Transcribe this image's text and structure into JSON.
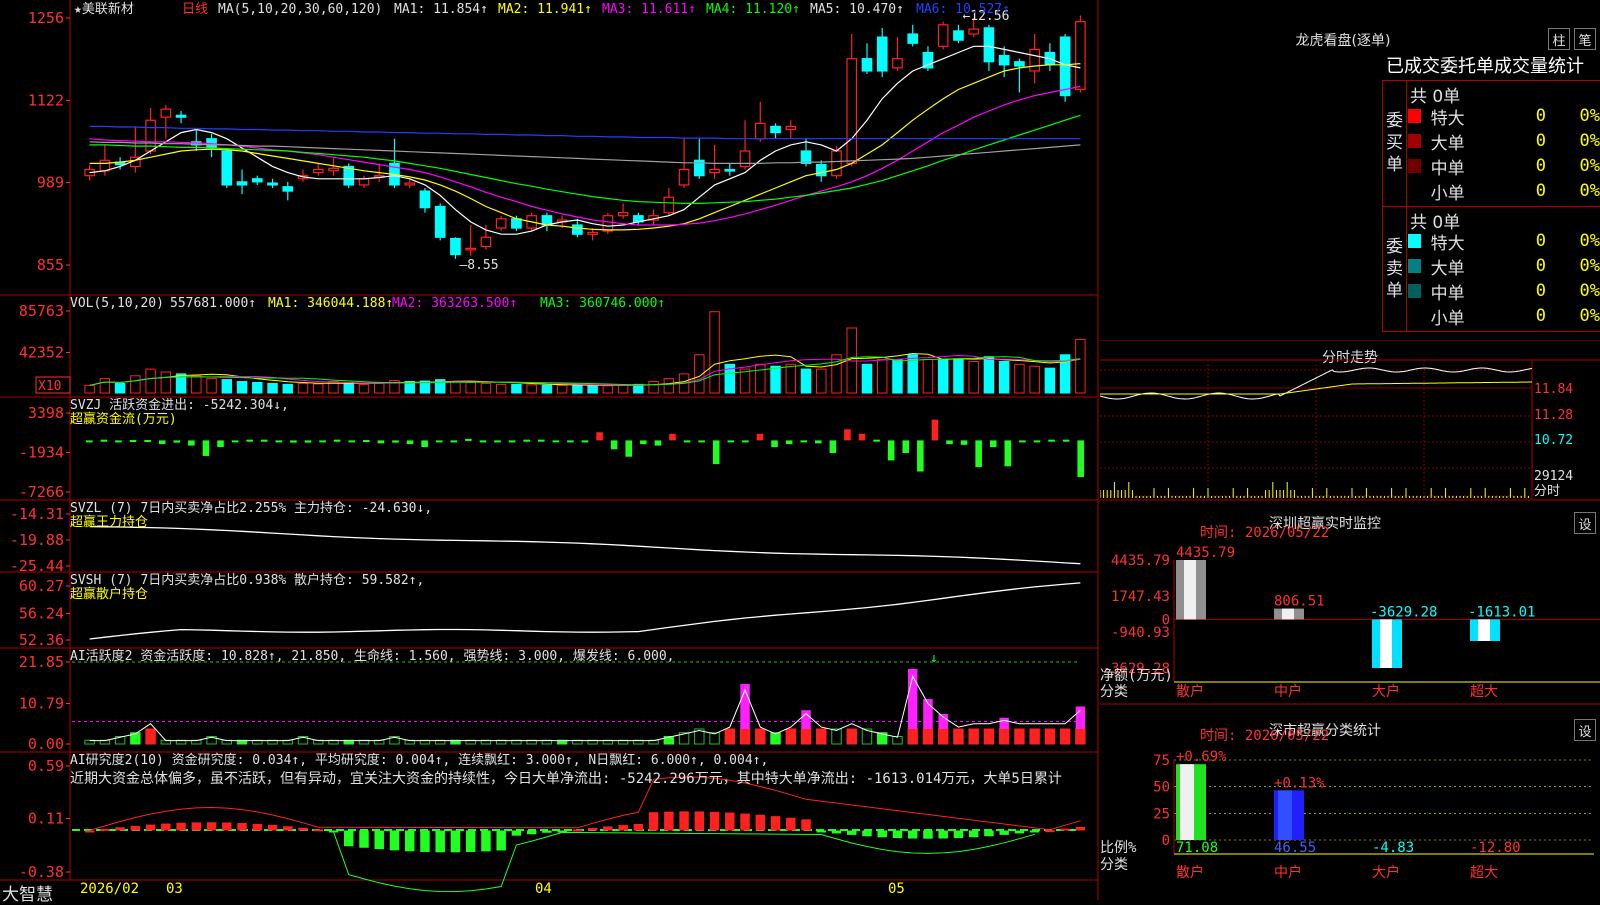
{
  "stock": {
    "name": "★美联新材",
    "period": "日线",
    "ma_params": "MA(5,10,20,30,60,120)",
    "ma1": "MA1: 11.854↑",
    "ma2": "MA2: 11.941↑",
    "ma3": "MA3: 11.611↑",
    "ma4": "MA4: 11.120↑",
    "ma5": "MA5: 10.470↑",
    "ma6": "MA6: 10.527↑",
    "high_mark": "12.56",
    "low_mark": "8.55",
    "y_ticks": [
      "1256",
      "1122",
      "989",
      "855"
    ]
  },
  "colors": {
    "up": "#ff2020",
    "down": "#00ffff",
    "ma1": "#ffffff",
    "ma2": "#ffff00",
    "ma3": "#ff00ff",
    "ma4": "#00ff00",
    "ma5": "#a0a0a0",
    "ma6": "#2040ff",
    "grid": "#b00000",
    "axis_text": "#ff3030"
  },
  "chart_data": [
    {
      "type": "candlestick",
      "title": "美联新材 日线",
      "ylim": [
        855,
        1256
      ],
      "candles": [
        {
          "o": 1000,
          "c": 1010,
          "h": 1018,
          "l": 992
        },
        {
          "o": 1008,
          "c": 1025,
          "h": 1050,
          "l": 1000
        },
        {
          "o": 1022,
          "c": 1018,
          "h": 1030,
          "l": 1010
        },
        {
          "o": 1015,
          "c": 1030,
          "h": 1080,
          "l": 1005
        },
        {
          "o": 1040,
          "c": 1090,
          "h": 1110,
          "l": 1035
        },
        {
          "o": 1095,
          "c": 1108,
          "h": 1115,
          "l": 1060
        },
        {
          "o": 1098,
          "c": 1095,
          "h": 1105,
          "l": 1085
        },
        {
          "o": 1055,
          "c": 1050,
          "h": 1075,
          "l": 1040
        },
        {
          "o": 1060,
          "c": 1045,
          "h": 1068,
          "l": 1030
        },
        {
          "o": 1040,
          "c": 985,
          "h": 1045,
          "l": 980
        },
        {
          "o": 990,
          "c": 985,
          "h": 1010,
          "l": 970
        },
        {
          "o": 995,
          "c": 990,
          "h": 1000,
          "l": 985
        },
        {
          "o": 988,
          "c": 985,
          "h": 995,
          "l": 980
        },
        {
          "o": 982,
          "c": 975,
          "h": 990,
          "l": 960
        },
        {
          "o": 995,
          "c": 1000,
          "h": 1010,
          "l": 990
        },
        {
          "o": 1005,
          "c": 1010,
          "h": 1020,
          "l": 1000
        },
        {
          "o": 1008,
          "c": 1012,
          "h": 1030,
          "l": 1000
        },
        {
          "o": 1015,
          "c": 985,
          "h": 1020,
          "l": 980
        },
        {
          "o": 985,
          "c": 995,
          "h": 1000,
          "l": 980
        },
        {
          "o": 1000,
          "c": 1000,
          "h": 1020,
          "l": 990
        },
        {
          "o": 1020,
          "c": 985,
          "h": 1060,
          "l": 980
        },
        {
          "o": 985,
          "c": 988,
          "h": 995,
          "l": 980
        },
        {
          "o": 975,
          "c": 948,
          "h": 980,
          "l": 940
        },
        {
          "o": 950,
          "c": 900,
          "h": 955,
          "l": 895
        },
        {
          "o": 898,
          "c": 872,
          "h": 900,
          "l": 865
        },
        {
          "o": 880,
          "c": 882,
          "h": 920,
          "l": 870
        },
        {
          "o": 885,
          "c": 900,
          "h": 920,
          "l": 880
        },
        {
          "o": 915,
          "c": 930,
          "h": 935,
          "l": 910
        },
        {
          "o": 930,
          "c": 915,
          "h": 935,
          "l": 910
        },
        {
          "o": 915,
          "c": 935,
          "h": 940,
          "l": 910
        },
        {
          "o": 935,
          "c": 920,
          "h": 940,
          "l": 910
        },
        {
          "o": 925,
          "c": 928,
          "h": 935,
          "l": 915
        },
        {
          "o": 920,
          "c": 905,
          "h": 930,
          "l": 900
        },
        {
          "o": 905,
          "c": 908,
          "h": 915,
          "l": 895
        },
        {
          "o": 910,
          "c": 935,
          "h": 940,
          "l": 905
        },
        {
          "o": 935,
          "c": 940,
          "h": 955,
          "l": 930
        },
        {
          "o": 935,
          "c": 925,
          "h": 940,
          "l": 920
        },
        {
          "o": 928,
          "c": 935,
          "h": 945,
          "l": 920
        },
        {
          "o": 940,
          "c": 965,
          "h": 980,
          "l": 935
        },
        {
          "o": 985,
          "c": 1010,
          "h": 1060,
          "l": 980
        },
        {
          "o": 1025,
          "c": 1000,
          "h": 1060,
          "l": 995
        },
        {
          "o": 1005,
          "c": 1010,
          "h": 1050,
          "l": 995
        },
        {
          "o": 1010,
          "c": 1008,
          "h": 1020,
          "l": 1000
        },
        {
          "o": 1015,
          "c": 1040,
          "h": 1090,
          "l": 1010
        },
        {
          "o": 1060,
          "c": 1085,
          "h": 1120,
          "l": 1055
        },
        {
          "o": 1080,
          "c": 1070,
          "h": 1085,
          "l": 1060
        },
        {
          "o": 1075,
          "c": 1080,
          "h": 1090,
          "l": 1060
        },
        {
          "o": 1040,
          "c": 1020,
          "h": 1060,
          "l": 1015
        },
        {
          "o": 1018,
          "c": 1000,
          "h": 1025,
          "l": 990
        },
        {
          "o": 1000,
          "c": 1040,
          "h": 1048,
          "l": 995
        },
        {
          "o": 1020,
          "c": 1190,
          "h": 1230,
          "l": 1015
        },
        {
          "o": 1190,
          "c": 1170,
          "h": 1215,
          "l": 1165
        },
        {
          "o": 1225,
          "c": 1170,
          "h": 1240,
          "l": 1160
        },
        {
          "o": 1175,
          "c": 1190,
          "h": 1225,
          "l": 1170
        },
        {
          "o": 1230,
          "c": 1215,
          "h": 1245,
          "l": 1210
        },
        {
          "o": 1200,
          "c": 1175,
          "h": 1210,
          "l": 1170
        },
        {
          "o": 1210,
          "c": 1245,
          "h": 1250,
          "l": 1205
        },
        {
          "o": 1235,
          "c": 1220,
          "h": 1245,
          "l": 1215
        },
        {
          "o": 1230,
          "c": 1238,
          "h": 1256,
          "l": 1225
        },
        {
          "o": 1240,
          "c": 1185,
          "h": 1245,
          "l": 1170
        },
        {
          "o": 1195,
          "c": 1180,
          "h": 1210,
          "l": 1160
        },
        {
          "o": 1185,
          "c": 1178,
          "h": 1190,
          "l": 1135
        },
        {
          "o": 1170,
          "c": 1205,
          "h": 1230,
          "l": 1150
        },
        {
          "o": 1200,
          "c": 1180,
          "h": 1215,
          "l": 1170
        },
        {
          "o": 1225,
          "c": 1130,
          "h": 1230,
          "l": 1120
        },
        {
          "o": 1140,
          "c": 1250,
          "h": 1260,
          "l": 1135
        }
      ],
      "ma_lines": {
        "ma1": [
          1005,
          1008,
          1015,
          1025,
          1040,
          1055,
          1070,
          1075,
          1070,
          1060,
          1045,
          1030,
          1015,
          1005,
          998,
          995,
          995,
          995,
          995,
          997,
          1000,
          995,
          985,
          968,
          945,
          925,
          912,
          905,
          905,
          910,
          920,
          925,
          928,
          922,
          918,
          920,
          925,
          930,
          935,
          945,
          965,
          985,
          995,
          1005,
          1025,
          1040,
          1050,
          1055,
          1050,
          1040,
          1060,
          1090,
          1125,
          1150,
          1170,
          1180,
          1190,
          1200,
          1210,
          1210,
          1205,
          1200,
          1195,
          1190,
          1180,
          1175
        ],
        "ma2": [
          1020,
          1020,
          1022,
          1025,
          1030,
          1035,
          1040,
          1042,
          1043,
          1042,
          1040,
          1036,
          1032,
          1028,
          1024,
          1020,
          1016,
          1012,
          1008,
          1005,
          1002,
          998,
          993,
          985,
          975,
          963,
          950,
          940,
          930,
          925,
          920,
          918,
          915,
          913,
          912,
          912,
          913,
          915,
          918,
          922,
          930,
          940,
          950,
          960,
          970,
          980,
          990,
          1000,
          1005,
          1010,
          1020,
          1035,
          1050,
          1070,
          1090,
          1108,
          1125,
          1140,
          1150,
          1160,
          1170,
          1175,
          1178,
          1180,
          1180,
          1182
        ],
        "ma3": [
          1060,
          1058,
          1057,
          1056,
          1055,
          1055,
          1054,
          1053,
          1052,
          1050,
          1048,
          1045,
          1042,
          1040,
          1037,
          1034,
          1030,
          1026,
          1022,
          1018,
          1014,
          1010,
          1005,
          998,
          990,
          982,
          973,
          965,
          958,
          950,
          944,
          938,
          933,
          928,
          925,
          922,
          920,
          920,
          920,
          921,
          923,
          927,
          932,
          938,
          945,
          952,
          960,
          968,
          975,
          982,
          990,
          1000,
          1012,
          1025,
          1040,
          1055,
          1070,
          1082,
          1095,
          1105,
          1115,
          1123,
          1130,
          1135,
          1140,
          1145
        ],
        "ma4": [
          1050,
          1050,
          1049,
          1048,
          1048,
          1047,
          1046,
          1046,
          1045,
          1044,
          1043,
          1042,
          1041,
          1040,
          1038,
          1036,
          1034,
          1032,
          1030,
          1027,
          1024,
          1020,
          1016,
          1012,
          1007,
          1002,
          997,
          992,
          987,
          983,
          978,
          974,
          970,
          966,
          963,
          960,
          958,
          957,
          956,
          955,
          955,
          956,
          957,
          958,
          960,
          962,
          965,
          968,
          972,
          976,
          980,
          986,
          992,
          1000,
          1008,
          1016,
          1025,
          1033,
          1042,
          1050,
          1058,
          1066,
          1074,
          1082,
          1090,
          1098
        ],
        "ma5": [
          1055,
          1054,
          1054,
          1053,
          1053,
          1052,
          1052,
          1051,
          1050,
          1050,
          1049,
          1048,
          1048,
          1047,
          1046,
          1045,
          1044,
          1043,
          1042,
          1041,
          1040,
          1039,
          1038,
          1037,
          1036,
          1035,
          1034,
          1033,
          1032,
          1031,
          1030,
          1029,
          1028,
          1027,
          1026,
          1025,
          1024,
          1023,
          1022,
          1021,
          1021,
          1020,
          1020,
          1020,
          1020,
          1021,
          1021,
          1022,
          1022,
          1023,
          1024,
          1025,
          1026,
          1027,
          1028,
          1030,
          1032,
          1034,
          1036,
          1038,
          1040,
          1042,
          1044,
          1046,
          1048,
          1050
        ],
        "ma6": [
          1080,
          1080,
          1079,
          1079,
          1078,
          1078,
          1077,
          1077,
          1076,
          1076,
          1075,
          1075,
          1074,
          1074,
          1073,
          1073,
          1072,
          1072,
          1071,
          1071,
          1070,
          1070,
          1069,
          1069,
          1068,
          1068,
          1067,
          1067,
          1066,
          1066,
          1065,
          1065,
          1064,
          1064,
          1063,
          1063,
          1062,
          1062,
          1062,
          1061,
          1061,
          1061,
          1060,
          1060,
          1060,
          1060,
          1060,
          1060,
          1060,
          1060,
          1060,
          1060,
          1060,
          1060,
          1060,
          1060,
          1060,
          1060,
          1060,
          1060,
          1060,
          1060,
          1060,
          1060,
          1060,
          1060
        ]
      }
    },
    {
      "type": "bar",
      "title": "VOL(5,10,20)",
      "ylim": [
        0,
        85763
      ],
      "y_ticks": [
        "85763",
        "42352",
        "X10"
      ],
      "values": [
        8000,
        15000,
        10000,
        18000,
        25000,
        22000,
        20000,
        18000,
        15000,
        14000,
        12000,
        11000,
        10000,
        9000,
        10000,
        9500,
        12000,
        11000,
        9000,
        10000,
        13000,
        12000,
        12500,
        14000,
        12000,
        11000,
        10000,
        9000,
        9000,
        8500,
        8000,
        8000,
        8000,
        7500,
        7500,
        8000,
        9000,
        12000,
        15000,
        20000,
        40000,
        85000,
        30000,
        25000,
        30000,
        28000,
        30000,
        25000,
        25000,
        40000,
        68000,
        30000,
        35000,
        35000,
        40000,
        35000,
        35000,
        35000,
        33000,
        38000,
        33000,
        30000,
        28000,
        26000,
        40000,
        56000
      ],
      "up_indices": [
        0,
        1,
        3,
        4,
        5,
        7,
        8,
        14,
        15,
        16,
        18,
        19,
        20,
        24,
        25,
        26,
        27,
        29,
        31,
        34,
        35,
        37,
        38,
        39,
        40,
        41,
        43,
        44,
        46,
        48,
        49,
        50,
        52,
        55,
        58,
        61,
        62,
        65
      ]
    }
  ],
  "vol": {
    "params": "VOL(5,10,20)",
    "value": "557681.000↑",
    "ma1": "MA1: 346044.188↑",
    "ma2": "MA2: 363263.500↑",
    "ma3": "MA3: 360746.000↑"
  },
  "svzj": {
    "title": "SVZJ  活跃资金进出: -5242.304↓,",
    "subtitle": "超赢资金流(万元)",
    "y_ticks": [
      "3398",
      "-1934",
      "-7266"
    ],
    "values": [
      -300,
      -200,
      -300,
      -250,
      -250,
      -800,
      -600,
      -1000,
      -2400,
      -1200,
      -300,
      -200,
      -200,
      -300,
      -600,
      -600,
      -300,
      -200,
      -400,
      -250,
      -700,
      -600,
      -800,
      -1200,
      -400,
      -300,
      -100,
      -500,
      -300,
      -500,
      -200,
      -200,
      -300,
      -300,
      -400,
      800,
      -1500,
      -2500,
      -800,
      -1000,
      600,
      -300,
      -400,
      -3500,
      -300,
      -400,
      600,
      -1200,
      -800,
      -400,
      -700,
      -2000,
      1200,
      600,
      -200,
      -3000,
      -2000,
      -4500,
      2500,
      -800,
      -900,
      -3900,
      -1200,
      -3800,
      -300,
      -300,
      -200,
      -200,
      -5242
    ]
  },
  "svzl": {
    "title": "SVZL (7) 7日内买卖净占比2.255% 主力持仓: -24.630↓,",
    "subtitle": "超赢王力持仓",
    "y_ticks": [
      "-14.31",
      "-19.88",
      "-25.44"
    ]
  },
  "svsh": {
    "title": "SVSH (7) 7日内买卖净占比0.938% 散户持仓: 59.582↑,",
    "subtitle": "超赢散户持仓",
    "y_ticks": [
      "60.27",
      "56.24",
      "52.36"
    ]
  },
  "ai_activity": {
    "title": "AI活跃度2 资金活跃度: 10.828↑, 21.850, 生命线: 1.560, 强势线: 3.000, 爆发线: 6.000,",
    "y_ticks": [
      "21.85",
      "10.79",
      "0.00"
    ]
  },
  "ai_research": {
    "title": "AI研究度2(10) 资金研究度: 0.034↑, 平均研究度: 0.004↑, 连续飘红: 3.000↑, N日飘红: 6.000↑, 0.004↑,",
    "comment": "近期大资金总体偏多，虽不活跃，但有异动，宜关注大资金的持续性，今日大单净流出: -5242.296万元，其中特大单净流出: -1613.014万元，大单5日累计",
    "y_ticks": [
      "0.59",
      "0.11",
      "-0.38"
    ]
  },
  "x_axis": [
    "2026/02",
    "03",
    "04",
    "05"
  ],
  "logo": "大智慧",
  "dragon": {
    "title": "龙虎看盘(逐单)",
    "btn_bar": "柱",
    "btn_pen": "笔",
    "tabs": "已成交委托单成交量统计",
    "buy_total": "共 0单",
    "sell_total": "共 0单",
    "buy_label": "委买单",
    "sell_label": "委卖单",
    "rows": [
      {
        "label": "特大",
        "count": "0",
        "pct": "0%"
      },
      {
        "label": "大单",
        "count": "0",
        "pct": "0%"
      },
      {
        "label": "中单",
        "count": "0",
        "pct": "0%"
      },
      {
        "label": "小单",
        "count": "0",
        "pct": "0%"
      }
    ]
  },
  "intraday": {
    "title": "分时走势",
    "y_ticks": [
      "11.84",
      "11.28",
      "10.72",
      "29124",
      "分时"
    ]
  },
  "sz_monitor": {
    "title": "深圳超赢实时监控",
    "btn": "设",
    "time": "时间: 2026/05/22",
    "y_ticks": [
      "4435.79",
      "1747.43",
      "0",
      "-940.93",
      "-3629.28"
    ],
    "axis_label": "净额(万元)",
    "axis_label2": "分类",
    "chart_data": {
      "type": "bar",
      "categories": [
        "散户",
        "中户",
        "大户",
        "超大"
      ],
      "values": [
        4435.79,
        806.51,
        -3629.28,
        -1613.01
      ],
      "value_labels": [
        "4435.79",
        "806.51",
        "-3629.28",
        "-1613.01"
      ],
      "ylim": [
        -3629.28,
        4435.79
      ]
    }
  },
  "sz_class": {
    "title": "深市超赢分类统计",
    "btn": "设",
    "time": "时间: 2026/05/22",
    "y_ticks": [
      "75",
      "50",
      "25",
      "0"
    ],
    "axis_label": "比例%",
    "axis_label2": "分类",
    "chart_data": {
      "type": "bar",
      "categories": [
        "散户",
        "中户",
        "大户",
        "超大"
      ],
      "values": [
        71.08,
        46.55,
        -4.83,
        -12.8
      ],
      "value_labels": [
        "71.08",
        "46.55",
        "-4.83",
        "-12.80"
      ],
      "change_labels": [
        "+0.69%",
        "+0.13%"
      ],
      "ylim": [
        0,
        75
      ]
    }
  }
}
